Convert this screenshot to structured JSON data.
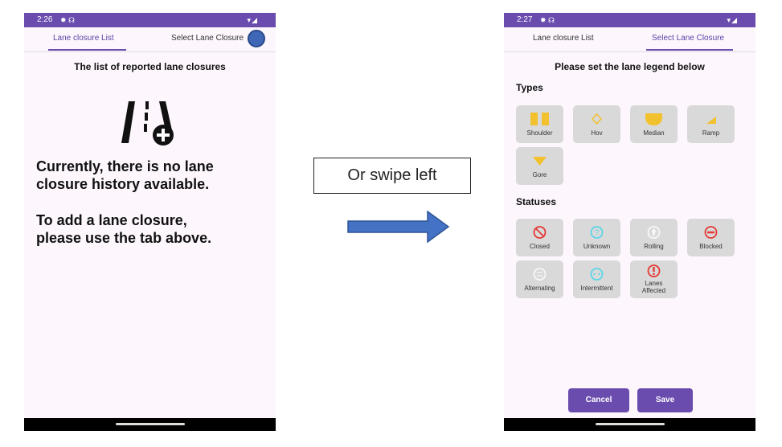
{
  "left_screen": {
    "status": {
      "time": "2:26",
      "icons": "✹ ☊",
      "signal": "▾◢"
    },
    "tabs": [
      {
        "label": "Lane closure List",
        "active": true
      },
      {
        "label": "Select Lane Closure",
        "active": false
      }
    ],
    "list_title": "The list of reported lane closures",
    "message_line1": "Currently, there is no lane",
    "message_line2": "closure history available.",
    "message_line3": "To add a lane closure,",
    "message_line4": "please use the tab above."
  },
  "swipe_text": "Or swipe left",
  "right_screen": {
    "status": {
      "time": "2:27",
      "icons": "✹ ☊",
      "signal": "▾◢"
    },
    "tabs": [
      {
        "label": "Lane closure List",
        "active": false
      },
      {
        "label": "Select Lane Closure",
        "active": true
      }
    ],
    "legend_title": "Please set the lane legend below",
    "types_heading": "Types",
    "types": [
      {
        "label": "Shoulder",
        "icon": "shoulder-icon"
      },
      {
        "label": "Hov",
        "icon": "hov-diamond-icon"
      },
      {
        "label": "Median",
        "icon": "median-icon"
      },
      {
        "label": "Ramp",
        "icon": "ramp-icon"
      },
      {
        "label": "Gore",
        "icon": "gore-icon"
      }
    ],
    "statuses_heading": "Statuses",
    "statuses": [
      {
        "label": "Closed",
        "icon": "closed-icon"
      },
      {
        "label": "Unknown",
        "icon": "unknown-icon"
      },
      {
        "label": "Rolling",
        "icon": "rolling-icon"
      },
      {
        "label": "Blocked",
        "icon": "blocked-icon"
      },
      {
        "label": "Alternating",
        "icon": "alternating-icon"
      },
      {
        "label": "Intermittent",
        "icon": "intermittent-icon"
      },
      {
        "label": "Lanes Affected",
        "icon": "lanes-affected-icon"
      }
    ],
    "cancel_label": "Cancel",
    "save_label": "Save"
  },
  "colors": {
    "accent": "#6a4cae",
    "yellow": "#f2c12e",
    "red": "#e53935",
    "cyan": "#5bd6e8",
    "arrow_blue": "#4472c4"
  }
}
